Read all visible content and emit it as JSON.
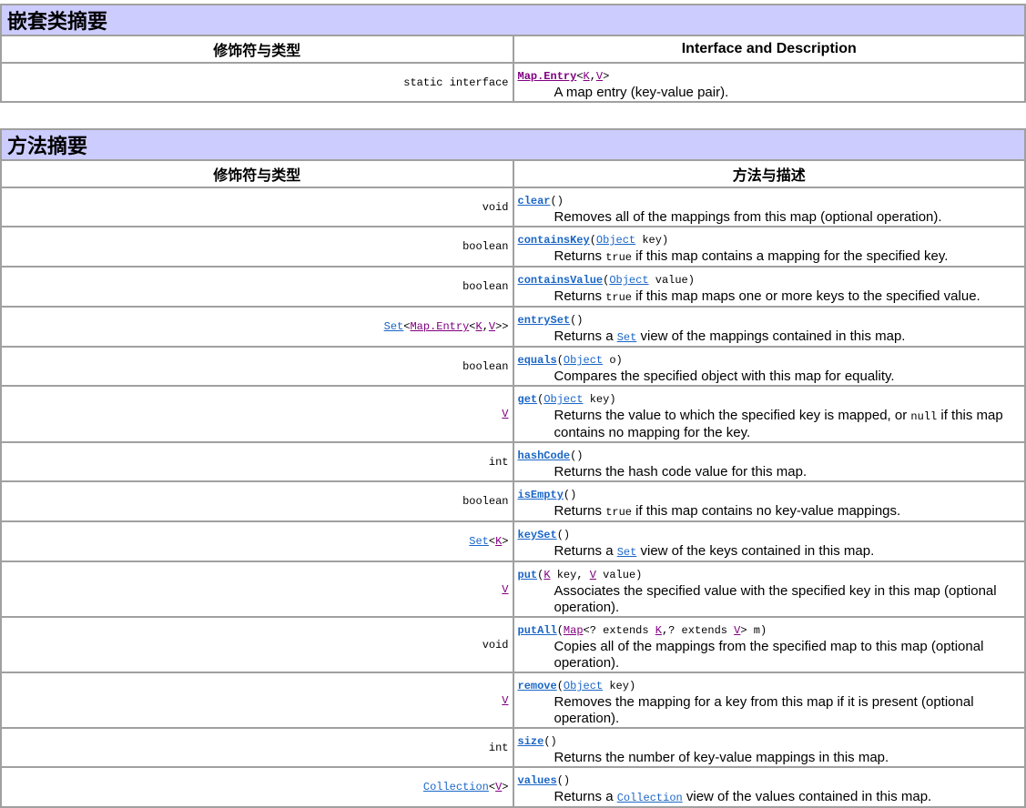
{
  "nested": {
    "title": "嵌套类摘要",
    "col1": "修饰符与类型",
    "col2": "Interface and Description",
    "rows": [
      {
        "type": [
          {
            "t": "static interface",
            "k": "text"
          }
        ],
        "name": {
          "t": "Map.Entry",
          "k": "vlink"
        },
        "params": [
          {
            "t": "<",
            "k": "text"
          },
          {
            "t": "K",
            "k": "vlink"
          },
          {
            "t": ",",
            "k": "text"
          },
          {
            "t": "V",
            "k": "vlink"
          },
          {
            "t": ">",
            "k": "text"
          }
        ],
        "desc": [
          {
            "t": "A map entry (key-value pair).",
            "k": "text"
          }
        ]
      }
    ]
  },
  "methods": {
    "title": "方法摘要",
    "col1": "修饰符与类型",
    "col2": "方法与描述",
    "rows": [
      {
        "type": [
          {
            "t": "void",
            "k": "text"
          }
        ],
        "name": {
          "t": "clear",
          "k": "link"
        },
        "params": [
          {
            "t": "()",
            "k": "text"
          }
        ],
        "desc": [
          {
            "t": "Removes all of the mappings from this map (optional operation).",
            "k": "text"
          }
        ]
      },
      {
        "type": [
          {
            "t": "boolean",
            "k": "text"
          }
        ],
        "name": {
          "t": "containsKey",
          "k": "link"
        },
        "params": [
          {
            "t": "(",
            "k": "text"
          },
          {
            "t": "Object",
            "k": "link"
          },
          {
            "t": " key)",
            "k": "text"
          }
        ],
        "desc": [
          {
            "t": "Returns ",
            "k": "text"
          },
          {
            "t": "true",
            "k": "code"
          },
          {
            "t": " if this map contains a mapping for the specified key.",
            "k": "text"
          }
        ]
      },
      {
        "type": [
          {
            "t": "boolean",
            "k": "text"
          }
        ],
        "name": {
          "t": "containsValue",
          "k": "link"
        },
        "params": [
          {
            "t": "(",
            "k": "text"
          },
          {
            "t": "Object",
            "k": "link"
          },
          {
            "t": " value)",
            "k": "text"
          }
        ],
        "desc": [
          {
            "t": "Returns ",
            "k": "text"
          },
          {
            "t": "true",
            "k": "code"
          },
          {
            "t": " if this map maps one or more keys to the specified value.",
            "k": "text"
          }
        ]
      },
      {
        "type": [
          {
            "t": "Set",
            "k": "link"
          },
          {
            "t": "<",
            "k": "text"
          },
          {
            "t": "Map.Entry",
            "k": "vlink"
          },
          {
            "t": "<",
            "k": "text"
          },
          {
            "t": "K",
            "k": "vlink"
          },
          {
            "t": ",",
            "k": "text"
          },
          {
            "t": "V",
            "k": "vlink"
          },
          {
            "t": ">>",
            "k": "text"
          }
        ],
        "name": {
          "t": "entrySet",
          "k": "link"
        },
        "params": [
          {
            "t": "()",
            "k": "text"
          }
        ],
        "desc": [
          {
            "t": "Returns a ",
            "k": "text"
          },
          {
            "t": "Set",
            "k": "link code"
          },
          {
            "t": " view of the mappings contained in this map.",
            "k": "text"
          }
        ]
      },
      {
        "type": [
          {
            "t": "boolean",
            "k": "text"
          }
        ],
        "name": {
          "t": "equals",
          "k": "link"
        },
        "params": [
          {
            "t": "(",
            "k": "text"
          },
          {
            "t": "Object",
            "k": "link"
          },
          {
            "t": " o)",
            "k": "text"
          }
        ],
        "desc": [
          {
            "t": "Compares the specified object with this map for equality.",
            "k": "text"
          }
        ]
      },
      {
        "type": [
          {
            "t": "V",
            "k": "vlink"
          }
        ],
        "name": {
          "t": "get",
          "k": "link"
        },
        "params": [
          {
            "t": "(",
            "k": "text"
          },
          {
            "t": "Object",
            "k": "link"
          },
          {
            "t": " key)",
            "k": "text"
          }
        ],
        "desc": [
          {
            "t": "Returns the value to which the specified key is mapped, or ",
            "k": "text"
          },
          {
            "t": "null",
            "k": "code"
          },
          {
            "t": " if this map contains no mapping for the key.",
            "k": "text"
          }
        ]
      },
      {
        "type": [
          {
            "t": "int",
            "k": "text"
          }
        ],
        "name": {
          "t": "hashCode",
          "k": "link"
        },
        "params": [
          {
            "t": "()",
            "k": "text"
          }
        ],
        "desc": [
          {
            "t": "Returns the hash code value for this map.",
            "k": "text"
          }
        ]
      },
      {
        "type": [
          {
            "t": "boolean",
            "k": "text"
          }
        ],
        "name": {
          "t": "isEmpty",
          "k": "link"
        },
        "params": [
          {
            "t": "()",
            "k": "text"
          }
        ],
        "desc": [
          {
            "t": "Returns ",
            "k": "text"
          },
          {
            "t": "true",
            "k": "code"
          },
          {
            "t": " if this map contains no key-value mappings.",
            "k": "text"
          }
        ]
      },
      {
        "type": [
          {
            "t": "Set",
            "k": "link"
          },
          {
            "t": "<",
            "k": "text"
          },
          {
            "t": "K",
            "k": "vlink"
          },
          {
            "t": ">",
            "k": "text"
          }
        ],
        "name": {
          "t": "keySet",
          "k": "link"
        },
        "params": [
          {
            "t": "()",
            "k": "text"
          }
        ],
        "desc": [
          {
            "t": "Returns a ",
            "k": "text"
          },
          {
            "t": "Set",
            "k": "link code"
          },
          {
            "t": " view of the keys contained in this map.",
            "k": "text"
          }
        ]
      },
      {
        "type": [
          {
            "t": "V",
            "k": "vlink"
          }
        ],
        "name": {
          "t": "put",
          "k": "link"
        },
        "params": [
          {
            "t": "(",
            "k": "text"
          },
          {
            "t": "K",
            "k": "vlink"
          },
          {
            "t": " key, ",
            "k": "text"
          },
          {
            "t": "V",
            "k": "vlink"
          },
          {
            "t": " value)",
            "k": "text"
          }
        ],
        "desc": [
          {
            "t": "Associates the specified value with the specified key in this map (optional operation).",
            "k": "text"
          }
        ]
      },
      {
        "type": [
          {
            "t": "void",
            "k": "text"
          }
        ],
        "name": {
          "t": "putAll",
          "k": "link"
        },
        "params": [
          {
            "t": "(",
            "k": "text"
          },
          {
            "t": "Map",
            "k": "vlink"
          },
          {
            "t": "<? extends ",
            "k": "text"
          },
          {
            "t": "K",
            "k": "vlink"
          },
          {
            "t": ",? extends ",
            "k": "text"
          },
          {
            "t": "V",
            "k": "vlink"
          },
          {
            "t": "> m)",
            "k": "text"
          }
        ],
        "desc": [
          {
            "t": "Copies all of the mappings from the specified map to this map (optional operation).",
            "k": "text"
          }
        ]
      },
      {
        "type": [
          {
            "t": "V",
            "k": "vlink"
          }
        ],
        "name": {
          "t": "remove",
          "k": "link"
        },
        "params": [
          {
            "t": "(",
            "k": "text"
          },
          {
            "t": "Object",
            "k": "link"
          },
          {
            "t": " key)",
            "k": "text"
          }
        ],
        "desc": [
          {
            "t": "Removes the mapping for a key from this map if it is present (optional operation).",
            "k": "text"
          }
        ]
      },
      {
        "type": [
          {
            "t": "int",
            "k": "text"
          }
        ],
        "name": {
          "t": "size",
          "k": "link"
        },
        "params": [
          {
            "t": "()",
            "k": "text"
          }
        ],
        "desc": [
          {
            "t": "Returns the number of key-value mappings in this map.",
            "k": "text"
          }
        ]
      },
      {
        "type": [
          {
            "t": "Collection",
            "k": "link"
          },
          {
            "t": "<",
            "k": "text"
          },
          {
            "t": "V",
            "k": "vlink"
          },
          {
            "t": ">",
            "k": "text"
          }
        ],
        "name": {
          "t": "values",
          "k": "link"
        },
        "params": [
          {
            "t": "()",
            "k": "text"
          }
        ],
        "desc": [
          {
            "t": "Returns a ",
            "k": "text"
          },
          {
            "t": "Collection",
            "k": "link code"
          },
          {
            "t": " view of the values contained in this map.",
            "k": "text"
          }
        ]
      }
    ]
  },
  "colors": {
    "heading_bg": "#ccccff",
    "link": "#1a66c6",
    "visited_link": "#800080",
    "border": "#a0a0a0"
  }
}
